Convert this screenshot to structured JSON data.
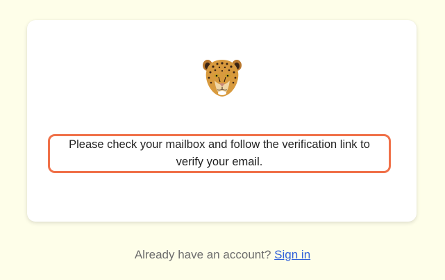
{
  "card": {
    "logo": {
      "icon": "leopard-head-icon"
    },
    "message": "Please check your mailbox and follow the verification link to verify your email."
  },
  "footer": {
    "prompt": "Already have an account?",
    "signin_label": "Sign in"
  },
  "colors": {
    "background": "#fefee9",
    "highlight_border": "#f07149",
    "link": "#2f5fd9"
  }
}
